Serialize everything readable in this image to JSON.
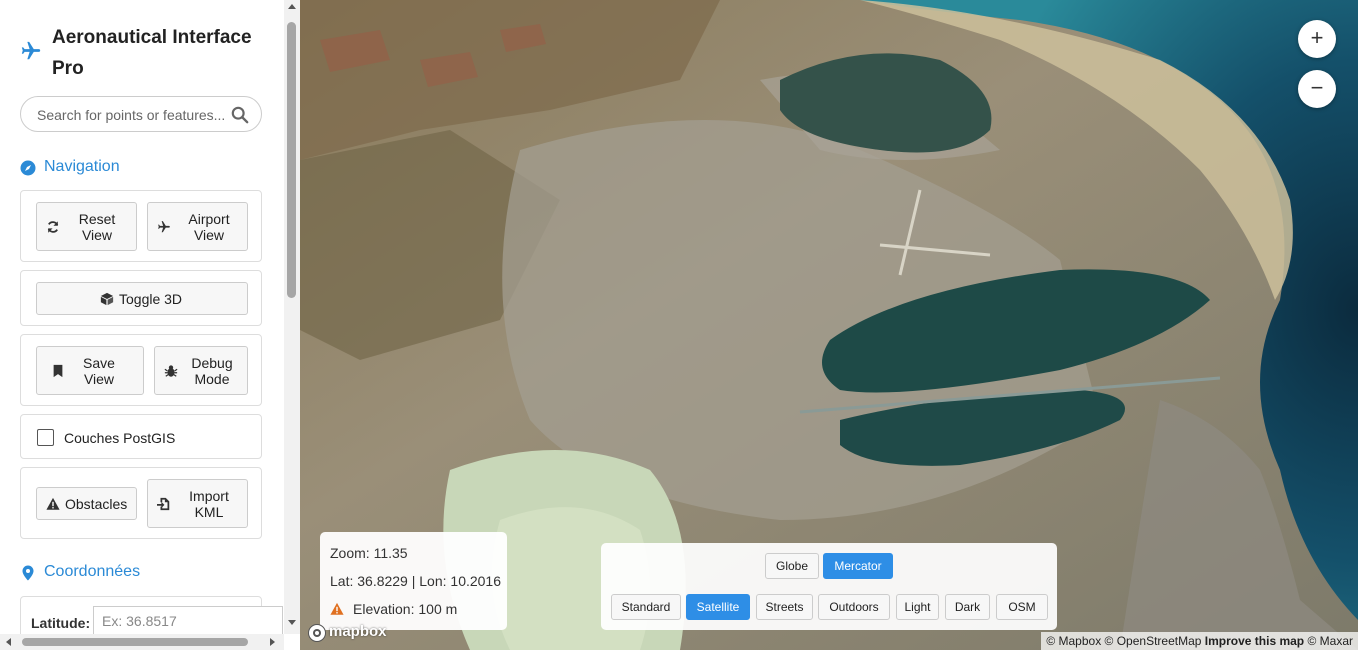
{
  "app": {
    "title": "Aeronautical Interface Pro"
  },
  "search": {
    "placeholder": "Search for points or features..."
  },
  "navigation": {
    "heading": "Navigation",
    "reset_view": [
      "Reset",
      "View"
    ],
    "airport_view": [
      "Airport",
      "View"
    ],
    "toggle_3d": "Toggle 3D",
    "save_view": [
      "Save",
      "View"
    ],
    "debug_mode": [
      "Debug",
      "Mode"
    ],
    "postgis_label": "Couches PostGIS",
    "postgis_checked": false,
    "obstacles": "Obstacles",
    "import_kml": [
      "Import",
      "KML"
    ]
  },
  "coordinates": {
    "heading": "Coordonnées",
    "latitude_label": "Latitude:",
    "latitude_placeholder": "Ex: 36.8517"
  },
  "map_info": {
    "zoom": "Zoom: 11.35",
    "latlon": "Lat: 36.8229 | Lon: 10.2016",
    "elevation": "Elevation: 100 m"
  },
  "projection": {
    "options": [
      "Globe",
      "Mercator"
    ],
    "active": "Mercator"
  },
  "styles": {
    "options": [
      "Standard",
      "Satellite",
      "Streets",
      "Outdoors",
      "Light",
      "Dark",
      "OSM"
    ],
    "active": "Satellite"
  },
  "zoom_controls": {
    "zoom_in": "+",
    "zoom_out": "−"
  },
  "attribution": {
    "mapbox": "© Mapbox",
    "osm": "© OpenStreetMap",
    "improve": "Improve this map",
    "maxar": "© Maxar"
  },
  "logo": {
    "text": "mapbox"
  },
  "colors": {
    "accent": "#2b8ad6",
    "active_button": "#2e8ee6",
    "warning": "#e07020"
  }
}
